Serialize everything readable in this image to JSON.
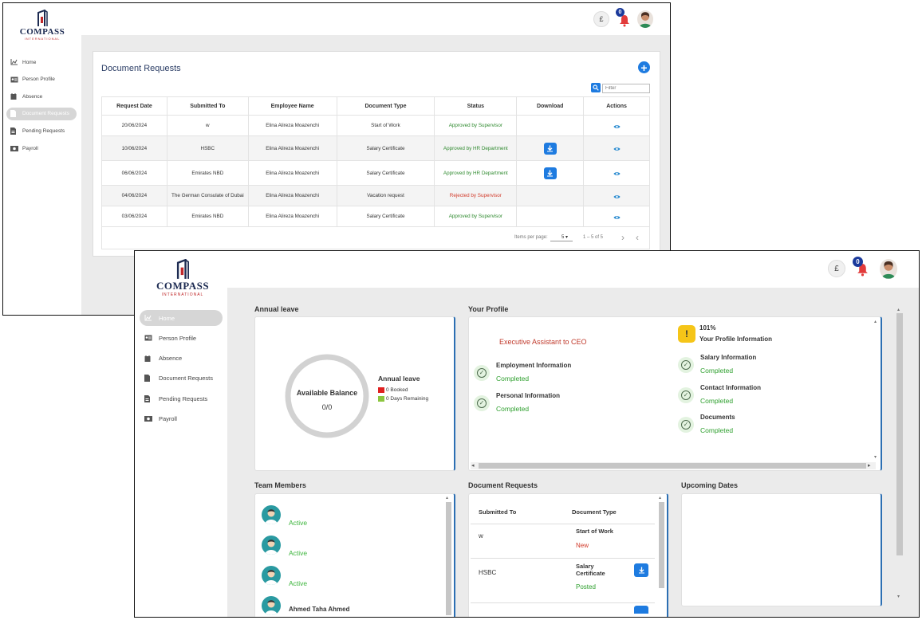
{
  "brand": {
    "name": "COMPASS",
    "tagline": "INTERNATIONAL"
  },
  "header": {
    "currency_symbol": "£",
    "notification_count": "0"
  },
  "sidebar": {
    "items": [
      {
        "label": "Home",
        "icon": "chart-icon"
      },
      {
        "label": "Person Profile",
        "icon": "id-card-icon"
      },
      {
        "label": "Absence",
        "icon": "calendar-icon"
      },
      {
        "label": "Document Requests",
        "icon": "document-icon"
      },
      {
        "label": "Pending Requests",
        "icon": "pending-document-icon"
      },
      {
        "label": "Payroll",
        "icon": "money-icon"
      }
    ]
  },
  "document_requests_page": {
    "title": "Document Requests",
    "filter_placeholder": "Filter",
    "columns": [
      "Request Date",
      "Submitted To",
      "Employee Name",
      "Document Type",
      "Status",
      "Download",
      "Actions"
    ],
    "rows": [
      {
        "date": "20/06/2024",
        "to": "w",
        "employee": "Elina Alireza Moazenchi",
        "type": "Start of Work",
        "status": "Approved by Supervisor",
        "status_color": "#2f8a2f",
        "download": false
      },
      {
        "date": "10/06/2024",
        "to": "HSBC",
        "employee": "Elina Alireza Moazenchi",
        "type": "Salary Certificate",
        "status": "Approved by HR Department",
        "status_color": "#2f8a2f",
        "download": true
      },
      {
        "date": "06/06/2024",
        "to": "Emirates NBD",
        "employee": "Elina Alireza Moazenchi",
        "type": "Salary Certificate",
        "status": "Approved by HR Department",
        "status_color": "#2f8a2f",
        "download": true
      },
      {
        "date": "04/06/2024",
        "to": "The German Consulate of Dubai",
        "employee": "Elina Alireza Moazenchi",
        "type": "Vacation request",
        "status": "Rejected by Supervisor",
        "status_color": "#d23a2a",
        "download": false
      },
      {
        "date": "03/06/2024",
        "to": "Emirates NBD",
        "employee": "Elina Alireza Moazenchi",
        "type": "Salary Certificate",
        "status": "Approved by Supervisor",
        "status_color": "#2f8a2f",
        "download": false
      }
    ],
    "paginator": {
      "items_per_page_label": "Items per page:",
      "page_size": "5",
      "range": "1 – 5 of 5"
    }
  },
  "dashboard": {
    "annual_leave": {
      "title": "Annual leave",
      "balance_label": "Available Balance",
      "balance_value": "0/0",
      "legend_title": "Annual leave",
      "legend": [
        {
          "label": "0 Booked",
          "color": "#e02020"
        },
        {
          "label": "0 Days Remaining",
          "color": "#8cc63f"
        }
      ]
    },
    "profile": {
      "title": "Your Profile",
      "job_title": "Executive Assistant to CEO",
      "completion": "101%",
      "completion_label": "Your Profile Information",
      "sections_left": [
        {
          "label": "Employment Information",
          "status": "Completed"
        },
        {
          "label": "Personal Information",
          "status": "Completed"
        }
      ],
      "sections_right": [
        {
          "label": "Salary Information",
          "status": "Completed"
        },
        {
          "label": "Contact Information",
          "status": "Completed"
        },
        {
          "label": "Documents",
          "status": "Completed"
        }
      ]
    },
    "team_members": {
      "title": "Team Members",
      "members": [
        {
          "name": "",
          "status": "Active"
        },
        {
          "name": "",
          "status": "Active"
        },
        {
          "name": "",
          "status": "Active"
        },
        {
          "name": "Ahmed Taha Ahmed",
          "status": ""
        }
      ]
    },
    "document_requests": {
      "title": "Document Requests",
      "columns": [
        "Submitted To",
        "Document Type"
      ],
      "rows": [
        {
          "to": "w",
          "type": "Start of Work",
          "status": "New",
          "status_color": "#d23a2a",
          "download": false
        },
        {
          "to": "HSBC",
          "type": "Salary Certificate",
          "status": "Posted",
          "status_color": "#2fa02f",
          "download": true
        }
      ]
    },
    "upcoming_dates": {
      "title": "Upcoming Dates"
    }
  }
}
